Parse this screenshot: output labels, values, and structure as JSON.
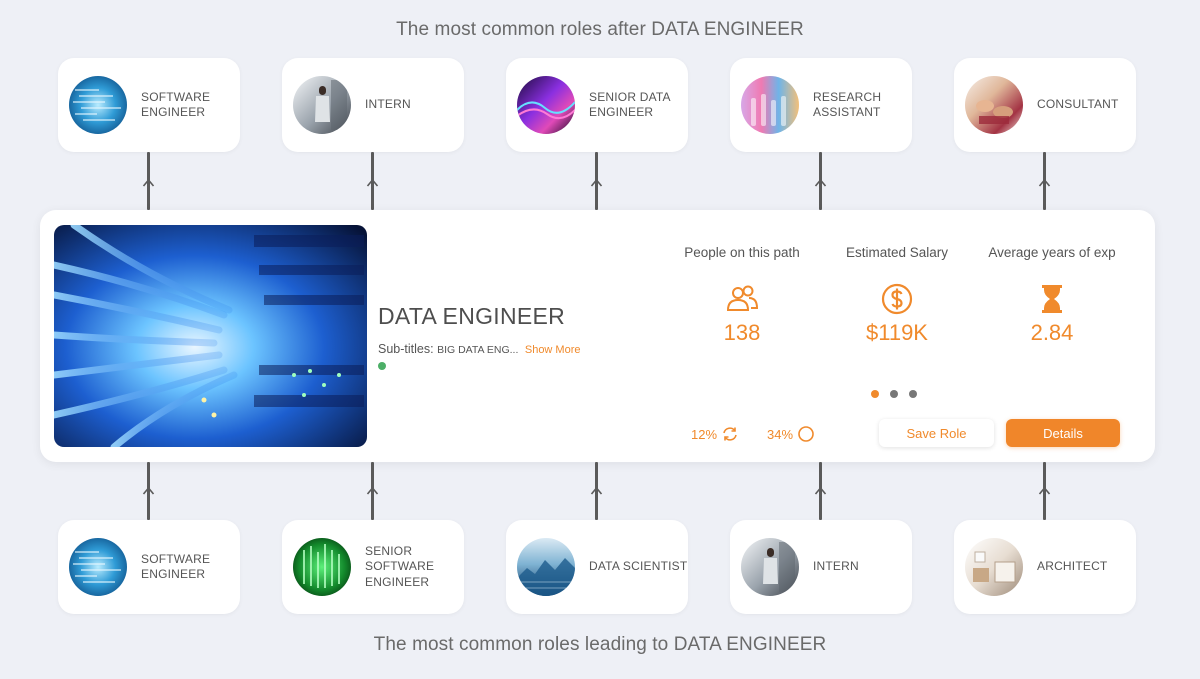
{
  "headings": {
    "after": "The most common roles after DATA ENGINEER",
    "before": "The most common roles leading to DATA ENGINEER"
  },
  "next_roles": [
    {
      "label": "SOFTWARE ENGINEER",
      "image": "code-screen"
    },
    {
      "label": "INTERN",
      "image": "person-office"
    },
    {
      "label": "SENIOR DATA ENGINEER",
      "image": "purple-waves"
    },
    {
      "label": "RESEARCH ASSISTANT",
      "image": "lab-tubes"
    },
    {
      "label": "CONSULTANT",
      "image": "meeting-hands"
    }
  ],
  "previous_roles": [
    {
      "label": "SOFTWARE ENGINEER",
      "image": "code-screen"
    },
    {
      "label": "SENIOR SOFTWARE ENGINEER",
      "image": "green-code"
    },
    {
      "label": "DATA SCIENTIST",
      "image": "data-landscape"
    },
    {
      "label": "INTERN",
      "image": "person-office"
    },
    {
      "label": "ARCHITECT",
      "image": "interior-room"
    }
  ],
  "current_role": {
    "title": "DATA ENGINEER",
    "subtitles_label": "Sub-titles:",
    "subtitles_value": "BIG DATA ENG...",
    "show_more": "Show More",
    "image": "server-cables"
  },
  "stats": [
    {
      "label": "People on this path",
      "icon": "people-icon",
      "value": "138"
    },
    {
      "label": "Estimated Salary",
      "icon": "dollar-icon",
      "value": "$119K"
    },
    {
      "label": "Average years of exp",
      "icon": "hourglass-icon",
      "value": "2.84"
    }
  ],
  "metrics": [
    {
      "value": "12%",
      "icon": "refresh-icon"
    },
    {
      "value": "34%",
      "icon": "circle-icon"
    }
  ],
  "pager": {
    "count": 3,
    "active_index": 0
  },
  "buttons": {
    "save": "Save Role",
    "details": "Details"
  },
  "colors": {
    "accent": "#f08a2c",
    "background": "#eef0f6",
    "status": "#4caf67"
  }
}
